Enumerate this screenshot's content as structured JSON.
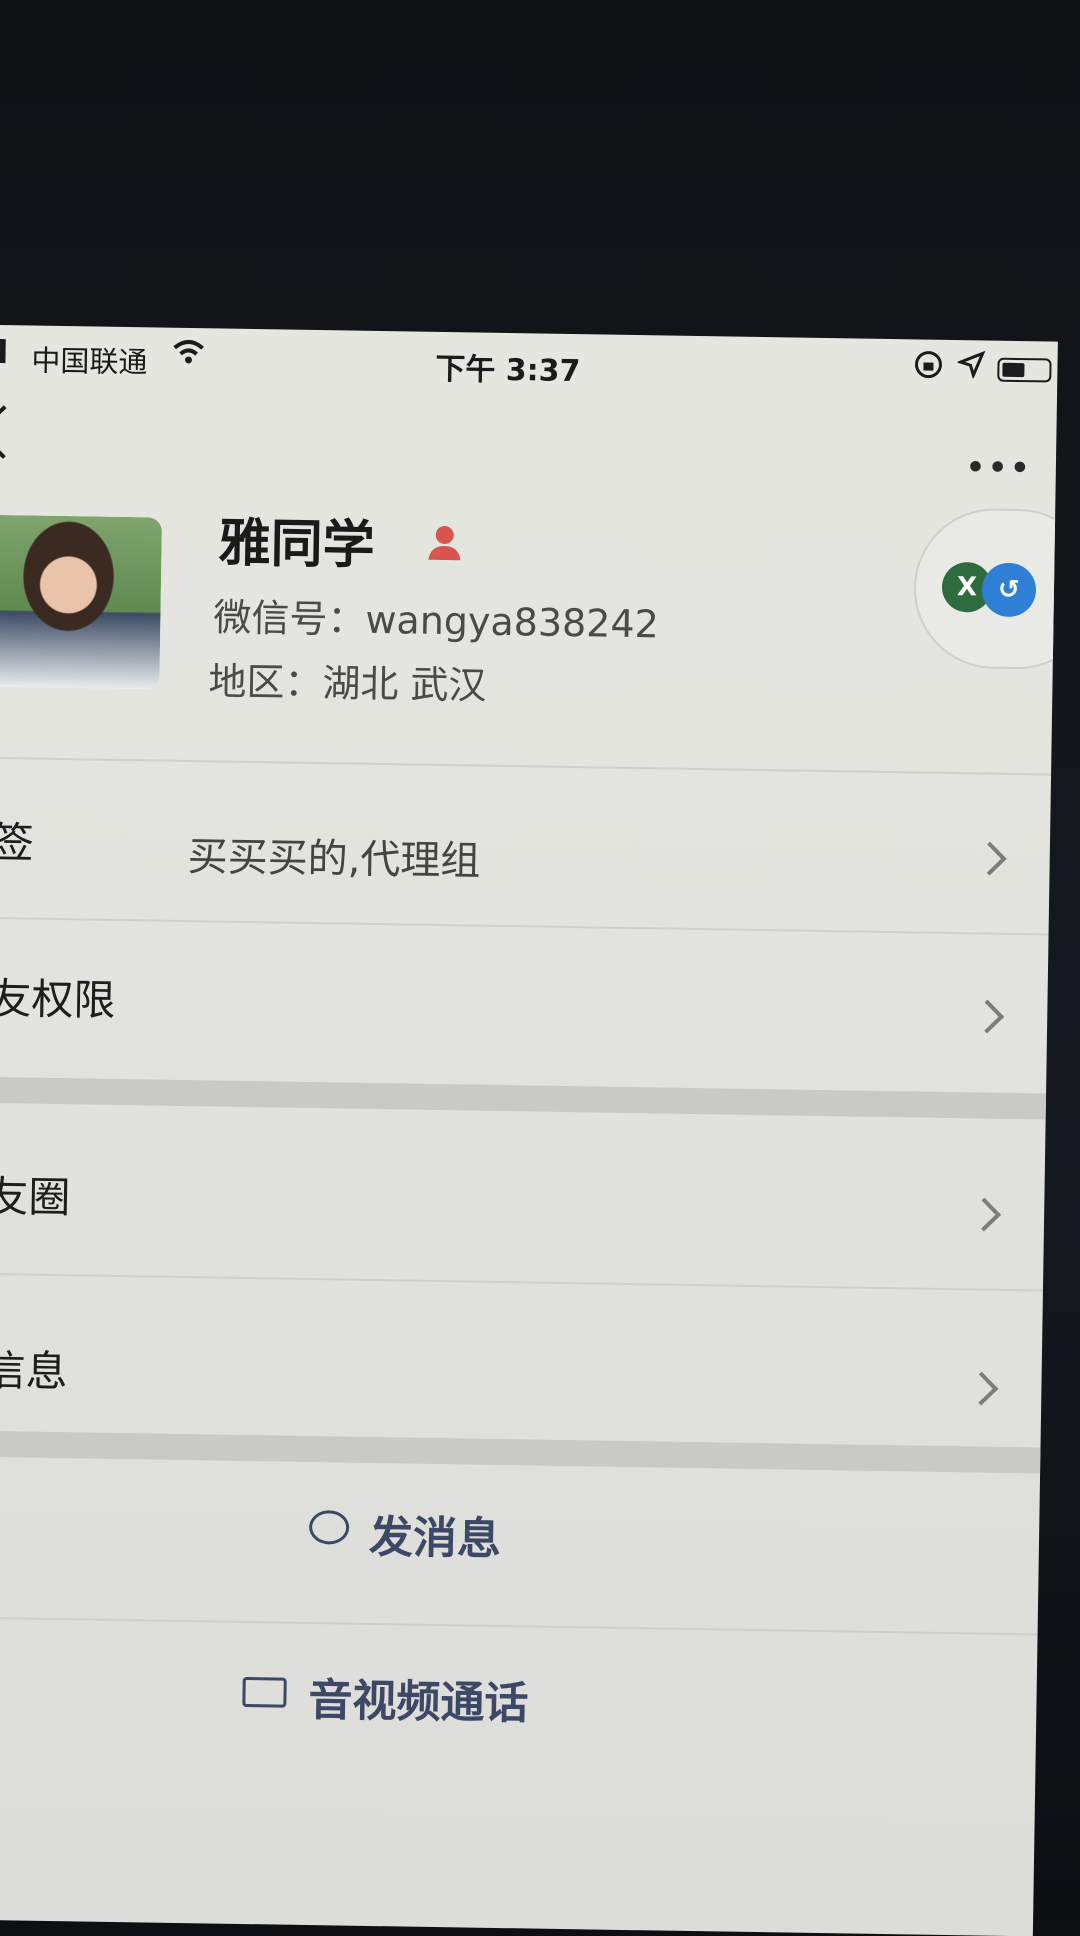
{
  "status_bar": {
    "carrier": "中国联通",
    "time": "下午 3:37"
  },
  "profile": {
    "name": "雅同学",
    "wechat_id": "微信号：wangya838242",
    "region": "地区：湖北 武汉"
  },
  "rows": [
    {
      "label": "签",
      "value": "买买买的,代理组"
    },
    {
      "label": "友权限",
      "value": ""
    },
    {
      "label": "友圈",
      "value": ""
    },
    {
      "label": "信息",
      "value": ""
    }
  ],
  "actions": {
    "send_message": "发消息",
    "av_call": "音视频通话"
  },
  "floating": {
    "x_label": "X"
  },
  "icons": {
    "back": "back-icon",
    "more": "more-icon",
    "gender": "female-icon",
    "message": "message-icon",
    "video": "video-icon",
    "chevron": "chevron-right-icon"
  },
  "colors": {
    "action_text": "#3d4866",
    "gender": "#d9534f"
  }
}
